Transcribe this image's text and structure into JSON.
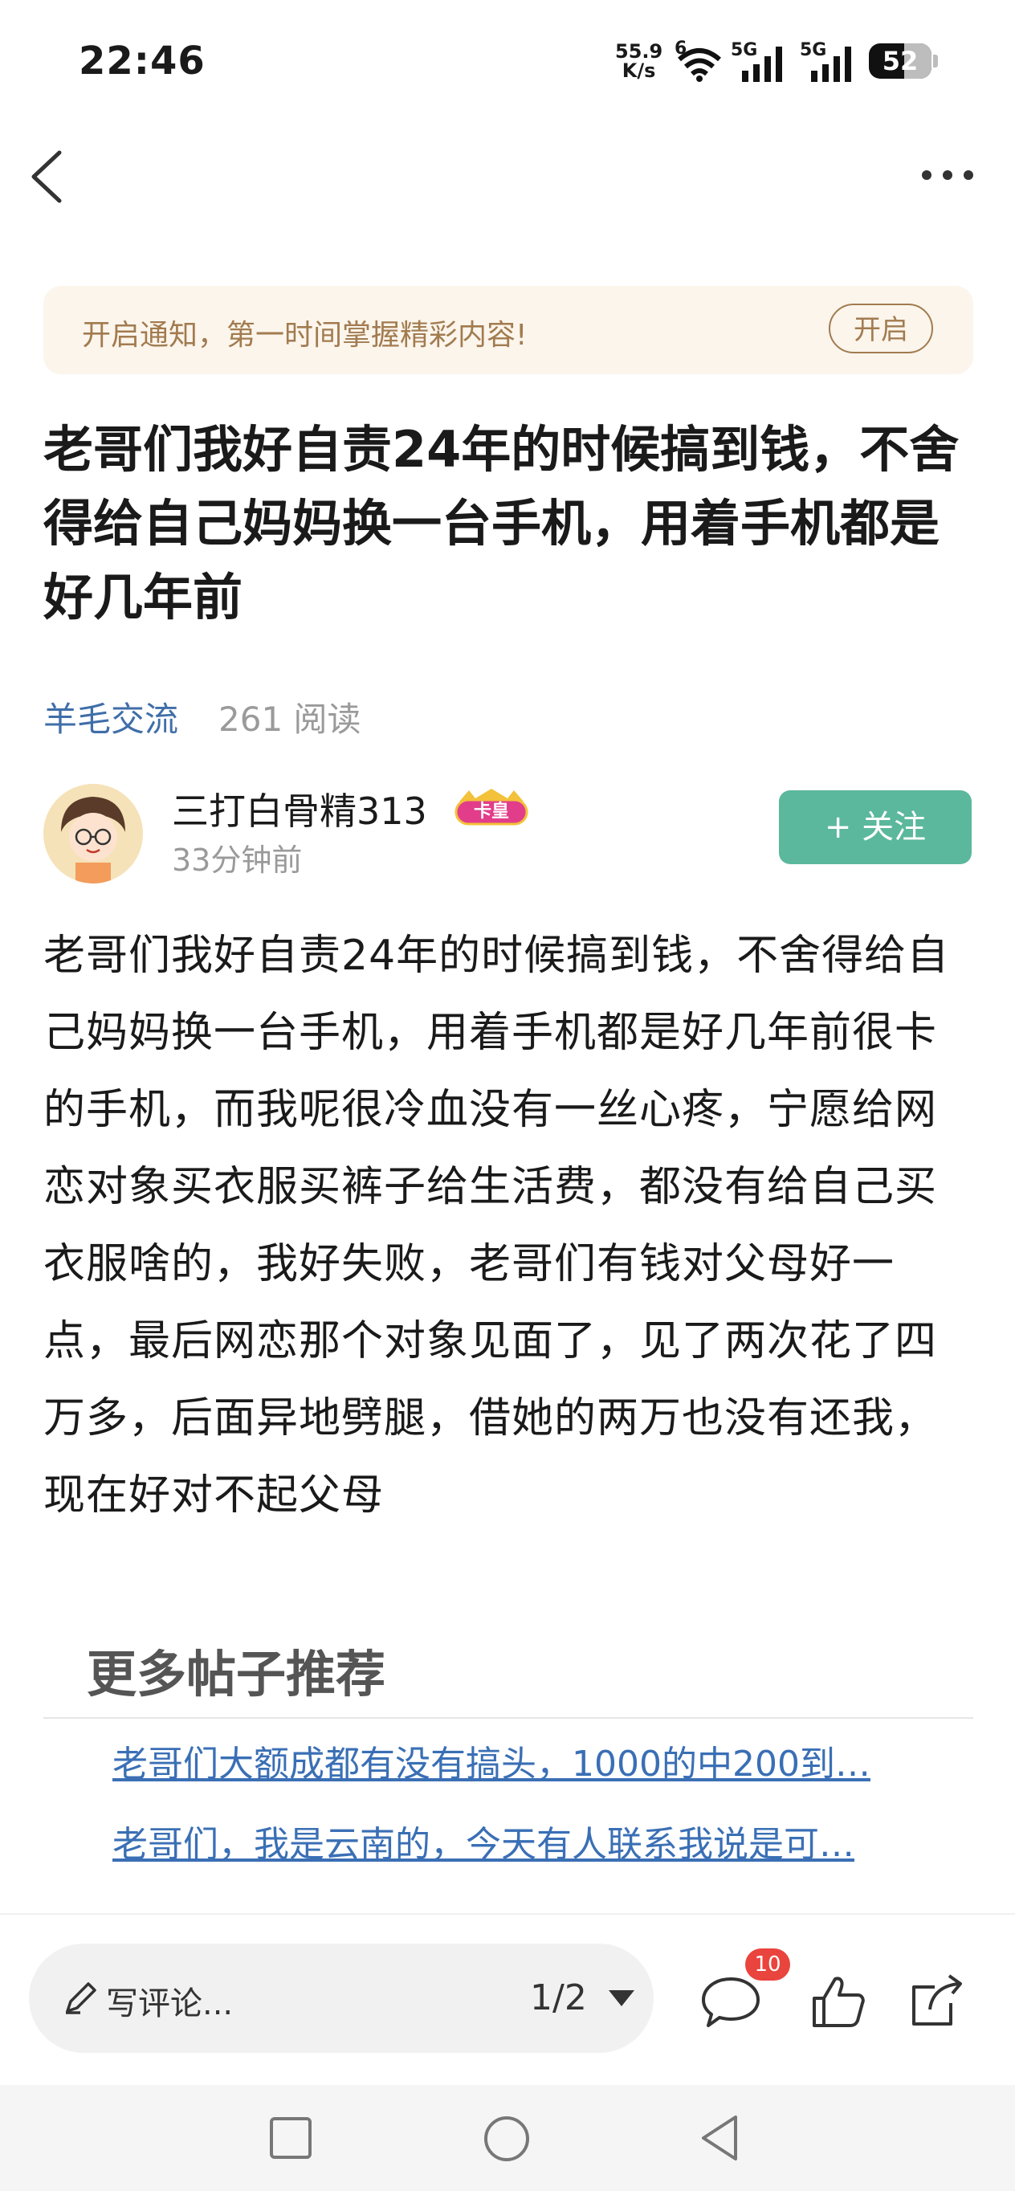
{
  "status_bar": {
    "time": "22:46",
    "speed_value": "55.9",
    "speed_unit": "K/s",
    "wifi_sub": "6",
    "signal1_label": "5G",
    "signal2_label": "5G",
    "battery": "52"
  },
  "notify": {
    "text": "开启通知，第一时间掌握精彩内容!",
    "button": "开启"
  },
  "post": {
    "title": "老哥们我好自责24年的时候搞到钱，不舍得给自己妈妈换一台手机，用着手机都是好几年前",
    "category": "羊毛交流",
    "reads": "261 阅读",
    "author_name": "三打白骨精313",
    "author_badge": "卡皇",
    "time_ago": "33分钟前",
    "follow_label": "+ 关注",
    "body": "老哥们我好自责24年的时候搞到钱，不舍得给自己妈妈换一台手机，用着手机都是好几年前很卡的手机，而我呢很冷血没有一丝心疼，宁愿给网恋对象买衣服买裤子给生活费，都没有给自己买衣服啥的，我好失败，老哥们有钱对父母好一点，最后网恋那个对象见面了，见了两次花了四万多，后面异地劈腿，借她的两万也没有还我，现在好对不起父母"
  },
  "recommend": {
    "title": "更多帖子推荐",
    "items": [
      "老哥们大额成都有没有搞头，1000的中200到…",
      "老哥们，我是云南的，今天有人联系我说是可…"
    ]
  },
  "bottom_bar": {
    "comment_placeholder": "写评论...",
    "page_indicator": "1/2",
    "comment_count": "10"
  },
  "colors": {
    "accent_green": "#5bb89c",
    "link_blue": "#3a6fb5",
    "notify_text": "#a27b4f",
    "badge_red": "#e9443d"
  }
}
